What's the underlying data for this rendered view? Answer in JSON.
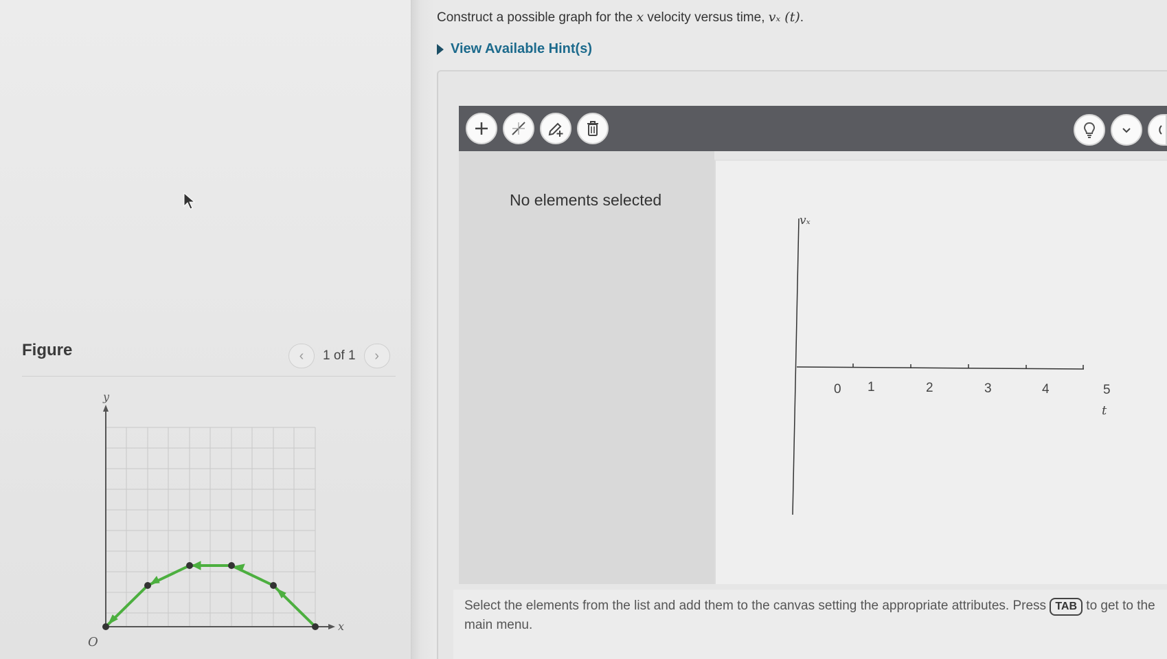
{
  "figure": {
    "heading": "Figure",
    "pager_text": "1 of 1",
    "prev_icon": "chevron-left-icon",
    "next_icon": "chevron-right-icon",
    "axis_y": "y",
    "axis_x": "x",
    "origin": "O",
    "grid_color": "#c8c8c8",
    "arrow_color": "#4caf3f"
  },
  "question": {
    "text_prefix": "Construct a possible graph for the ",
    "text_x": "x",
    "text_mid": " velocity versus time, ",
    "text_math": "vₓ (t)",
    "text_suffix": "."
  },
  "hint": {
    "label": "View Available Hint(s)"
  },
  "toolbar": {
    "add_icon": "plus-icon",
    "slope_icon": "slope-line-icon",
    "add_point_icon": "pencil-plus-icon",
    "delete_icon": "trash-icon",
    "hint_icon": "lightbulb-icon",
    "menu_icon": "chevron-down-icon",
    "reset_icon": "refresh-icon"
  },
  "side_panel": {
    "empty_message": "No elements selected"
  },
  "canvas": {
    "y_label": "vₓ",
    "x_label": "t",
    "x_ticks": [
      "0",
      "1",
      "2",
      "3",
      "4",
      "5"
    ]
  },
  "instructions": {
    "before": "Select the elements from the list and add them to the canvas setting the appropriate attributes. Press ",
    "key": "TAB",
    "after": " to get to the main menu."
  }
}
